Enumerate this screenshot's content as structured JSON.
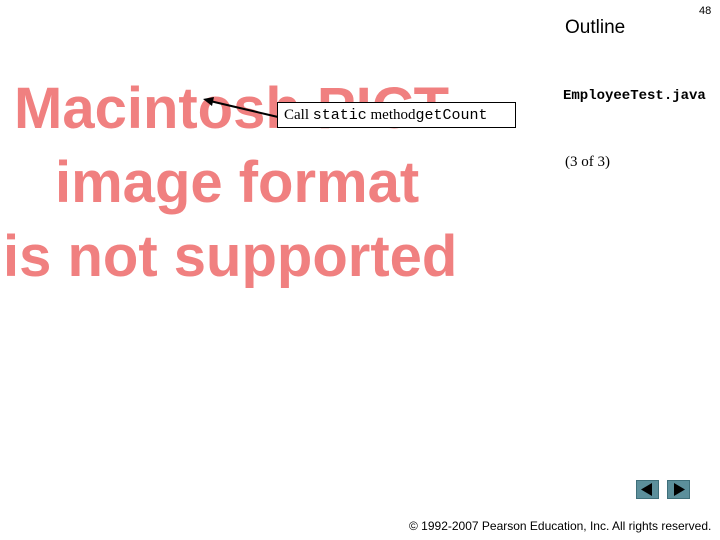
{
  "header": {
    "outline_label": "Outline",
    "page_number": "48"
  },
  "image_placeholder": {
    "lines": [
      "Macintosh PICT",
      "image format",
      "is not supported"
    ],
    "color": "#f08080"
  },
  "callout": {
    "prefix": "Call",
    "keyword": "static",
    "middle": "method",
    "method_name": "getCount"
  },
  "sidebar": {
    "filename": "EmployeeTest.java",
    "page_info": "(3 of 3)"
  },
  "nav": {
    "prev_icon": "triangle-left-icon",
    "next_icon": "triangle-right-icon",
    "button_color": "#5c8f9b"
  },
  "footer": {
    "copyright": "© 1992-2007 Pearson Education, Inc.  All rights reserved."
  }
}
